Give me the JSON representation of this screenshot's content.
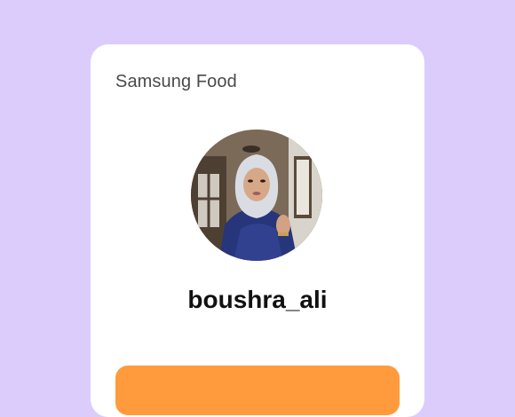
{
  "page": {
    "background_color": "#dcccfc"
  },
  "card": {
    "brand_name": "Samsung Food",
    "profile": {
      "username": "boushra_ali",
      "avatar": "profile-photo"
    },
    "primary_button": {
      "label": "",
      "color": "#ff9b3c"
    }
  }
}
